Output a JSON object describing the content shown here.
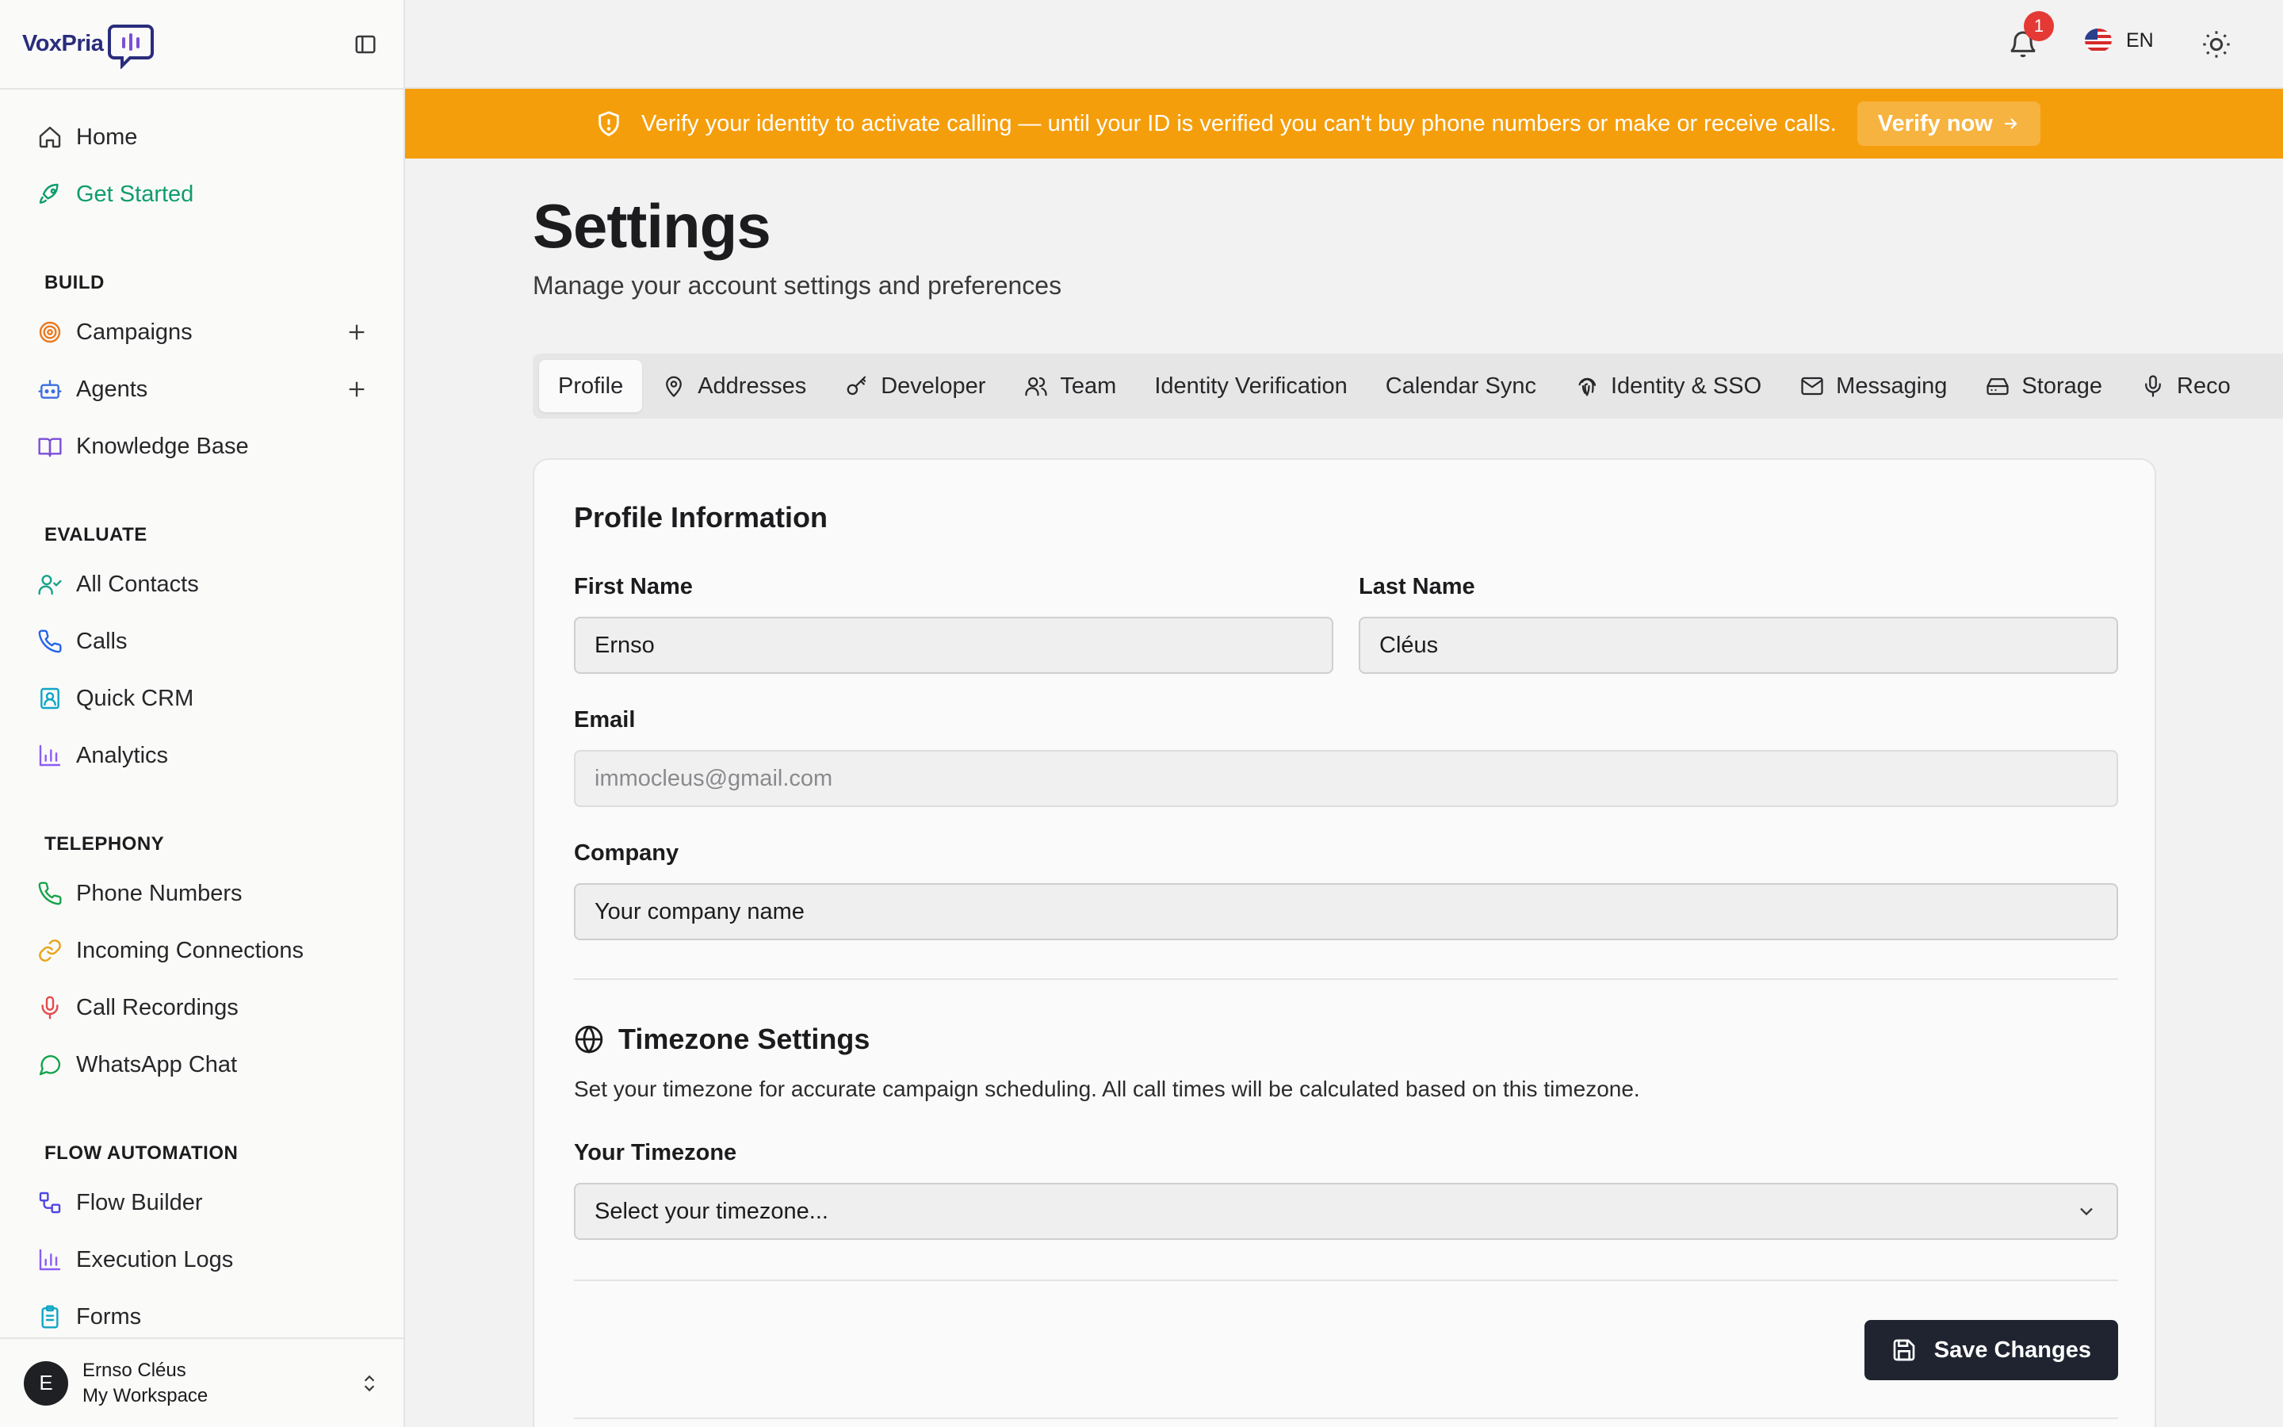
{
  "app": {
    "logo_text": "VoxPria",
    "accent": "#0f9d6e",
    "banner_color": "#f59e0b"
  },
  "sidebar": {
    "top_items": [
      {
        "label": "Home",
        "icon": "home-icon"
      },
      {
        "label": "Get Started",
        "icon": "rocket-icon",
        "active": true
      }
    ],
    "sections": [
      {
        "title": "BUILD",
        "items": [
          {
            "label": "Campaigns",
            "icon": "target-icon",
            "has_add": true
          },
          {
            "label": "Agents",
            "icon": "bot-icon",
            "has_add": true
          },
          {
            "label": "Knowledge Base",
            "icon": "book-icon"
          }
        ]
      },
      {
        "title": "EVALUATE",
        "items": [
          {
            "label": "All Contacts",
            "icon": "user-check-icon"
          },
          {
            "label": "Calls",
            "icon": "phone-icon"
          },
          {
            "label": "Quick CRM",
            "icon": "contact-card-icon"
          },
          {
            "label": "Analytics",
            "icon": "bar-chart-icon"
          }
        ]
      },
      {
        "title": "TELEPHONY",
        "items": [
          {
            "label": "Phone Numbers",
            "icon": "phone-icon"
          },
          {
            "label": "Incoming Connections",
            "icon": "link-icon"
          },
          {
            "label": "Call Recordings",
            "icon": "mic-icon"
          },
          {
            "label": "WhatsApp Chat",
            "icon": "chat-bubble-icon"
          }
        ]
      },
      {
        "title": "FLOW AUTOMATION",
        "items": [
          {
            "label": "Flow Builder",
            "icon": "workflow-icon"
          },
          {
            "label": "Execution Logs",
            "icon": "bar-chart-icon"
          },
          {
            "label": "Forms",
            "icon": "clipboard-icon"
          }
        ]
      }
    ],
    "user": {
      "initial": "E",
      "name": "Ernso Cléus",
      "workspace": "My Workspace"
    }
  },
  "topbar": {
    "notification_count": "1",
    "language": "EN"
  },
  "banner": {
    "text": "Verify your identity to activate calling — until your ID is verified you can't buy phone numbers or make or receive calls.",
    "button": "Verify now"
  },
  "page": {
    "title": "Settings",
    "subtitle": "Manage your account settings and preferences"
  },
  "tabs": [
    {
      "label": "Profile",
      "icon": "",
      "active": true
    },
    {
      "label": "Addresses",
      "icon": "map-pin-icon"
    },
    {
      "label": "Developer",
      "icon": "key-icon"
    },
    {
      "label": "Team",
      "icon": "users-icon"
    },
    {
      "label": "Identity Verification",
      "icon": ""
    },
    {
      "label": "Calendar Sync",
      "icon": ""
    },
    {
      "label": "Identity & SSO",
      "icon": "fingerprint-icon"
    },
    {
      "label": "Messaging",
      "icon": "mail-icon"
    },
    {
      "label": "Storage",
      "icon": "hard-drive-icon"
    },
    {
      "label": "Reco",
      "icon": "mic-icon"
    }
  ],
  "profile": {
    "section_title": "Profile Information",
    "first_name_label": "First Name",
    "first_name_value": "Ernso",
    "last_name_label": "Last Name",
    "last_name_value": "Cléus",
    "email_label": "Email",
    "email_value": "immocleus@gmail.com",
    "company_label": "Company",
    "company_placeholder": "Your company name"
  },
  "timezone": {
    "title": "Timezone Settings",
    "description": "Set your timezone for accurate campaign scheduling. All call times will be calculated based on this timezone.",
    "label": "Your Timezone",
    "placeholder": "Select your timezone..."
  },
  "actions": {
    "save_label": "Save Changes"
  }
}
